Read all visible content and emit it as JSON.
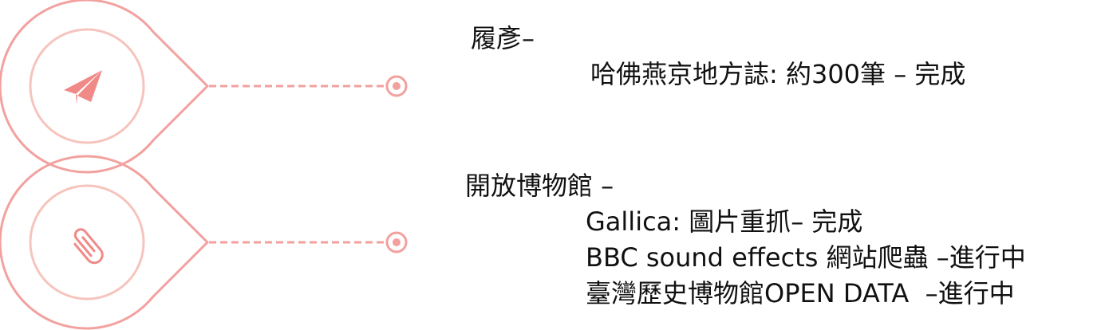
{
  "sections": [
    {
      "heading": "履彥–",
      "icon": "paper-plane-icon",
      "items": [
        "哈佛燕京地方誌: 約300筆 – 完成"
      ]
    },
    {
      "heading": "開放博物館 –",
      "icon": "paperclip-icon",
      "items": [
        "Gallica: 圖片重抓– 完成",
        "BBC sound effects 網站爬蟲 –進行中",
        "臺灣歷史博物館OPEN DATA  –進行中"
      ]
    }
  ],
  "colors": {
    "outline": "#f2a19f",
    "inner_ring": "#f6c4bd",
    "icon": "#f08a88",
    "text": "#111111"
  }
}
